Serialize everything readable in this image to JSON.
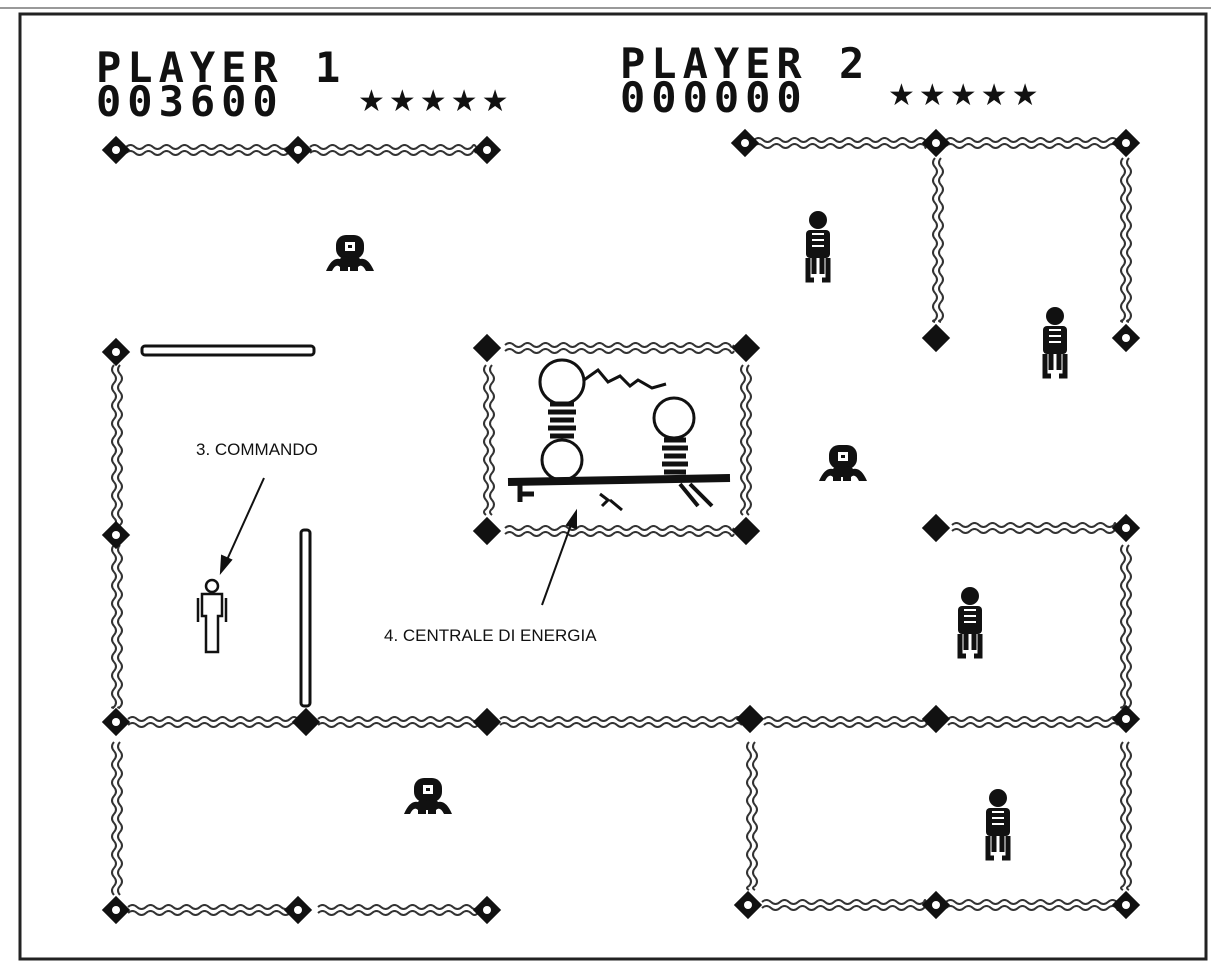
{
  "player1": {
    "label": "PLAYER 1",
    "score": "003600",
    "lives": "★★★★★"
  },
  "player2": {
    "label": "PLAYER 2",
    "score": "000000",
    "lives": "★★★★★"
  },
  "captions": {
    "commando": "3. COMMANDO",
    "power_station": "4. CENTRALE DI ENERGIA"
  },
  "colors": {
    "ink": "#111111",
    "paper": "#ffffff"
  }
}
